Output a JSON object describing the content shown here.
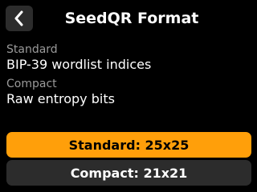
{
  "header": {
    "title": "SeedQR Format",
    "back_icon": "chevron-left-icon"
  },
  "options": {
    "standard": {
      "label": "Standard",
      "description": "BIP-39 wordlist indices"
    },
    "compact": {
      "label": "Compact",
      "description": "Raw entropy bits"
    }
  },
  "buttons": {
    "standard": {
      "label": "Standard: 25x25",
      "selected": true
    },
    "compact": {
      "label": "Compact: 21x21",
      "selected": false
    }
  },
  "colors": {
    "background": "#000000",
    "accent": "#ff9f0a",
    "button_bg": "#2c2c2c",
    "secondary_text": "#9a9a9a"
  }
}
